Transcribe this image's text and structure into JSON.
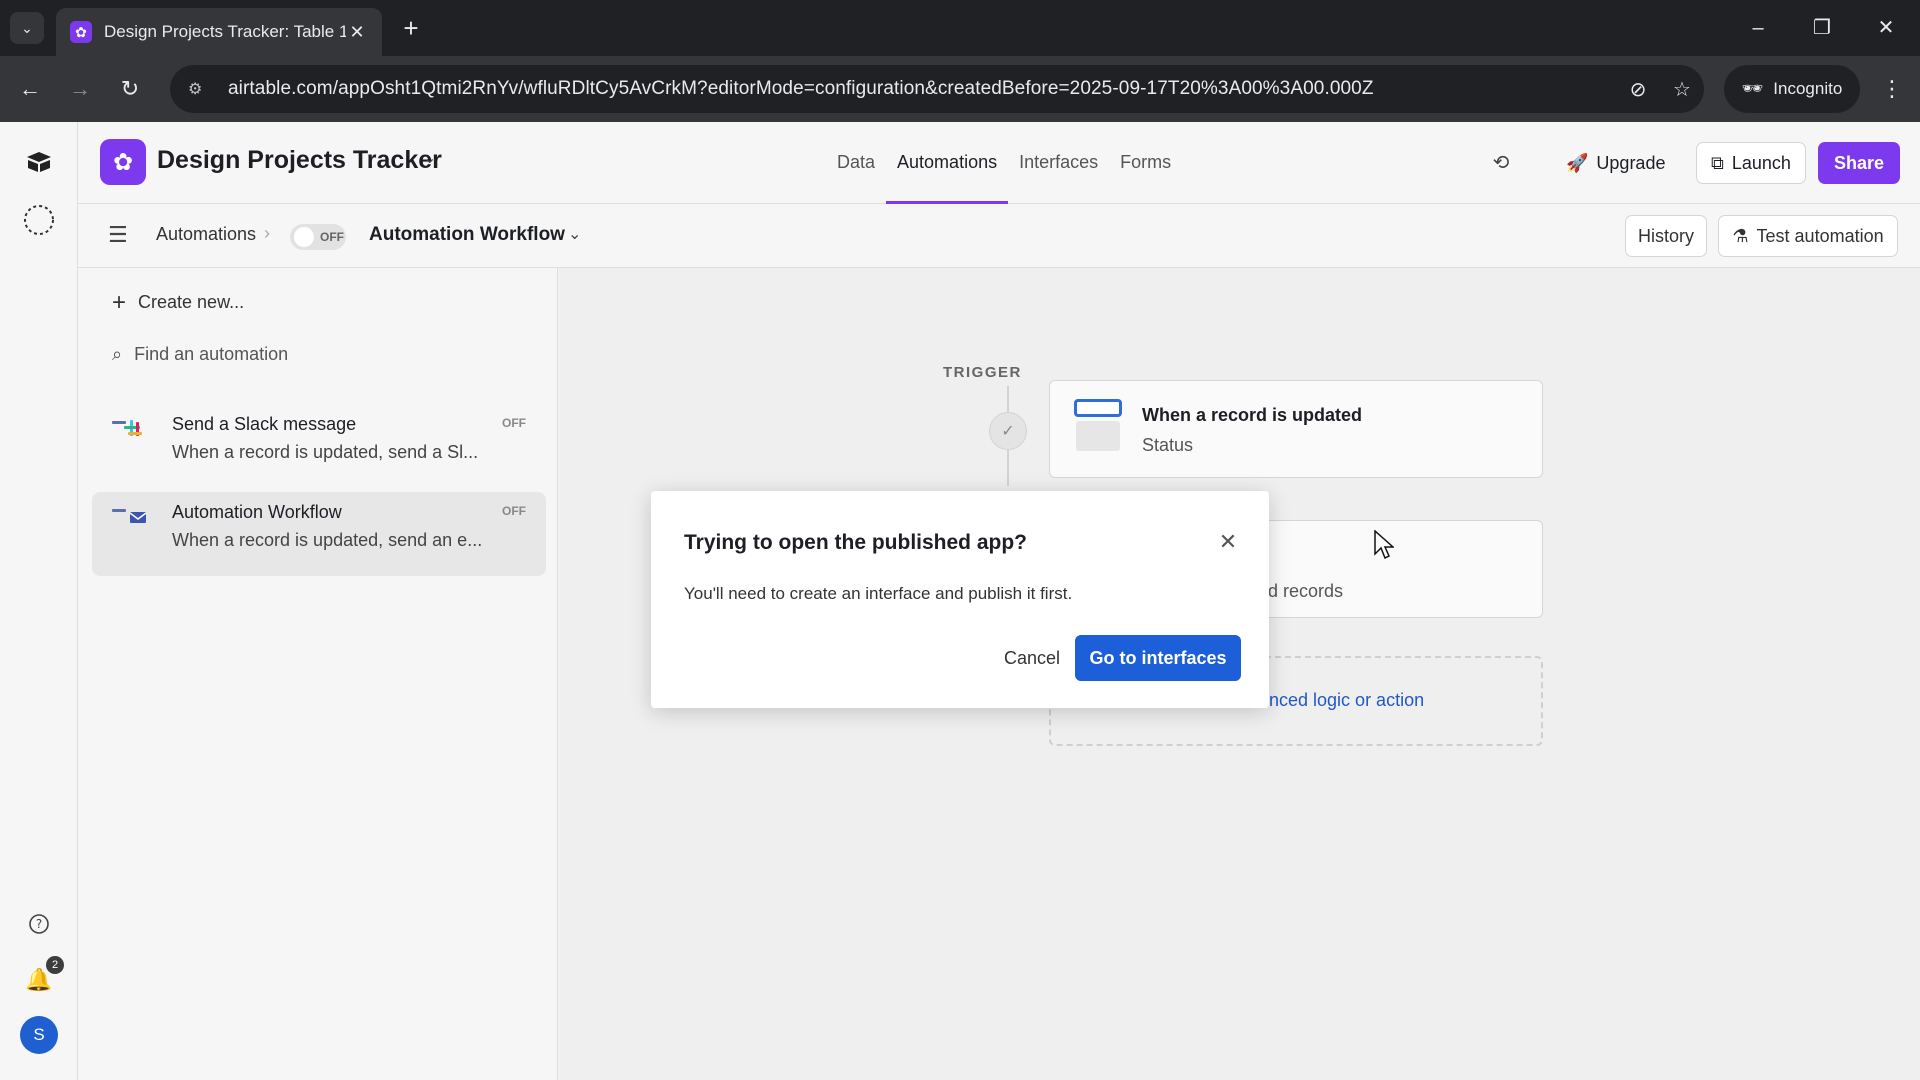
{
  "browser": {
    "tab_title": "Design Projects Tracker: Table 1",
    "url": "airtable.com/appOsht1Qtmi2RnYv/wfluRDltCy5AvCrkM?editorMode=configuration&createdBefore=2025-09-17T20%3A00%3A00.000Z",
    "incognito_label": "Incognito"
  },
  "rail": {
    "notification_count": "2",
    "avatar_initial": "S"
  },
  "header": {
    "base_name": "Design Projects Tracker",
    "tabs": [
      {
        "label": "Data"
      },
      {
        "label": "Automations"
      },
      {
        "label": "Interfaces"
      },
      {
        "label": "Forms"
      }
    ],
    "active_tab": "Automations",
    "upgrade_label": "Upgrade",
    "launch_label": "Launch",
    "share_label": "Share",
    "accent_color": "#7c39ed"
  },
  "subheader": {
    "breadcrumb": "Automations",
    "toggle_label": "OFF",
    "workflow_name": "Automation Workflow",
    "history_label": "History",
    "test_label": "Test automation"
  },
  "sidebar": {
    "create_label": "Create new...",
    "search_placeholder": "Find an automation",
    "items": [
      {
        "name": "Send a Slack message",
        "desc": "When a record is updated, send a Sl...",
        "status": "OFF"
      },
      {
        "name": "Automation Workflow",
        "desc": "When a record is updated, send an e...",
        "status": "OFF"
      }
    ]
  },
  "canvas": {
    "trigger_label": "TRIGGER",
    "trigger_title": "When a record is updated",
    "trigger_sub": "Status",
    "action_sub_partial": "d records",
    "add_partial": "nced logic or action"
  },
  "modal": {
    "title": "Trying to open the published app?",
    "body": "You'll need to create an interface and publish it first.",
    "cancel_label": "Cancel",
    "confirm_label": "Go to interfaces",
    "confirm_color": "#1d5fd8"
  }
}
